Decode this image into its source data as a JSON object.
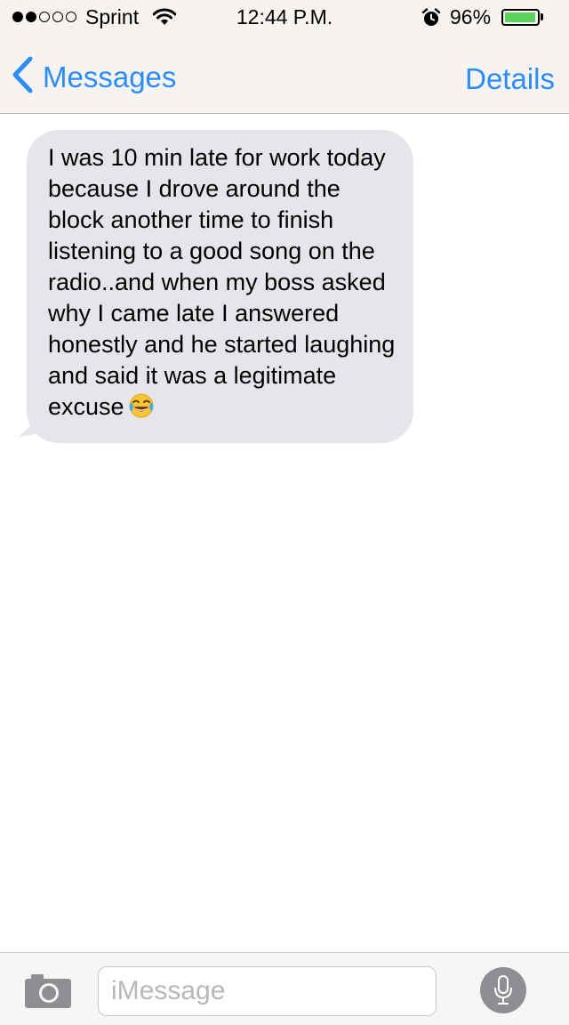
{
  "status_bar": {
    "signal_bars_filled": 2,
    "signal_bars_total": 5,
    "carrier": "Sprint",
    "time": "12:44 P.M.",
    "battery_percent": "96%",
    "battery_level": 0.96,
    "battery_color": "#5bd25b",
    "icons": [
      "signal-dots-icon",
      "wifi-icon",
      "alarm-icon",
      "battery-icon"
    ]
  },
  "nav_bar": {
    "back_label": "Messages",
    "details_label": "Details",
    "accent_color": "#2b8df5",
    "icons": [
      "chevron-left-icon"
    ]
  },
  "conversation": {
    "messages": [
      {
        "direction": "incoming",
        "bubble_color": "#e5e5ea",
        "text": "I was 10 min late for work today because I drove around the block another time to finish listening to a good song on the radio..and when my boss asked why I came late I answered honestly and he started laughing and said it was a legitimate excuse",
        "emoji": "tears-of-joy-emoji"
      }
    ]
  },
  "input_bar": {
    "placeholder": "iMessage",
    "value": "",
    "icons": [
      "camera-icon",
      "microphone-icon"
    ]
  }
}
